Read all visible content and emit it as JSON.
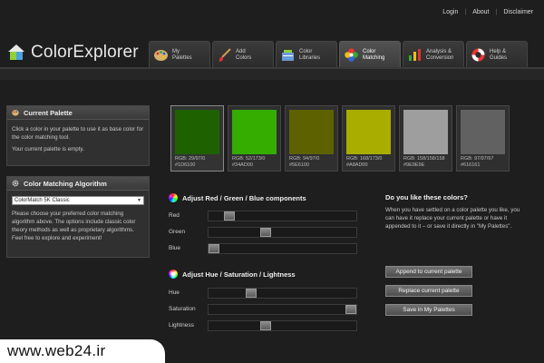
{
  "top_links": [
    "Login",
    "About",
    "Disclaimer"
  ],
  "logo": {
    "text": "ColorExplorer"
  },
  "tabs": [
    {
      "label": "My\nPalettes",
      "icon": "palette-icon"
    },
    {
      "label": "Add\nColors",
      "icon": "brush-icon"
    },
    {
      "label": "Color\nLibraries",
      "icon": "library-icon"
    },
    {
      "label": "Color\nMatching",
      "icon": "color-flower-icon"
    },
    {
      "label": "Analysis &\nConversion",
      "icon": "analysis-icon"
    },
    {
      "label": "Help &\nGuides",
      "icon": "lifebuoy-icon"
    }
  ],
  "active_tab": 3,
  "current_palette": {
    "title": "Current Palette",
    "text1": "Click a color in your palette to use it as base color for the color matching tool.",
    "text2": "Your current palette is empty."
  },
  "algorithm": {
    "title": "Color Matching Algorithm",
    "selected": "ColorMatch 5K Classic",
    "text": "Please choose your preferred color matching algorithm above. The options include classic color theory methods as well as proprietary algorithms. Feel free to explore and experiment!"
  },
  "swatches": [
    {
      "color": "#1D6100",
      "rgb": "RGB: 29/97/0",
      "hex": "#1D6100"
    },
    {
      "color": "#34AD00",
      "rgb": "RGB: 52/173/0",
      "hex": "#34AD00"
    },
    {
      "color": "#5E6100",
      "rgb": "RGB: 94/97/0",
      "hex": "#5E6100"
    },
    {
      "color": "#A8AD00",
      "rgb": "RGB: 168/173/0",
      "hex": "#A8AD00"
    },
    {
      "color": "#9E9E9E",
      "rgb": "RGB: 158/158/158",
      "hex": "#9E9E9E"
    },
    {
      "color": "#616161",
      "rgb": "RGB: 97/97/97",
      "hex": "#616161"
    }
  ],
  "rgb_section": {
    "title": "Adjust Red / Green / Blue components",
    "sliders": [
      {
        "label": "Red",
        "value": 0.11
      },
      {
        "label": "Green",
        "value": 0.38
      },
      {
        "label": "Blue",
        "value": 0.0
      }
    ]
  },
  "hsl_section": {
    "title": "Adjust Hue / Saturation / Lightness",
    "sliders": [
      {
        "label": "Hue",
        "value": 0.27
      },
      {
        "label": "Saturation",
        "value": 1.0
      },
      {
        "label": "Lightness",
        "value": 0.38
      }
    ]
  },
  "like_section": {
    "title": "Do you like these colors?",
    "text": "When you have settled on a color palette you like, you can have it replace your current palette or have it appended to it – or save it directly in \"My Palettes\"."
  },
  "buttons": {
    "append": "Append to current palette",
    "replace": "Replace current palette",
    "save": "Save in My Palettes"
  },
  "watermark": "www.web24.ir"
}
